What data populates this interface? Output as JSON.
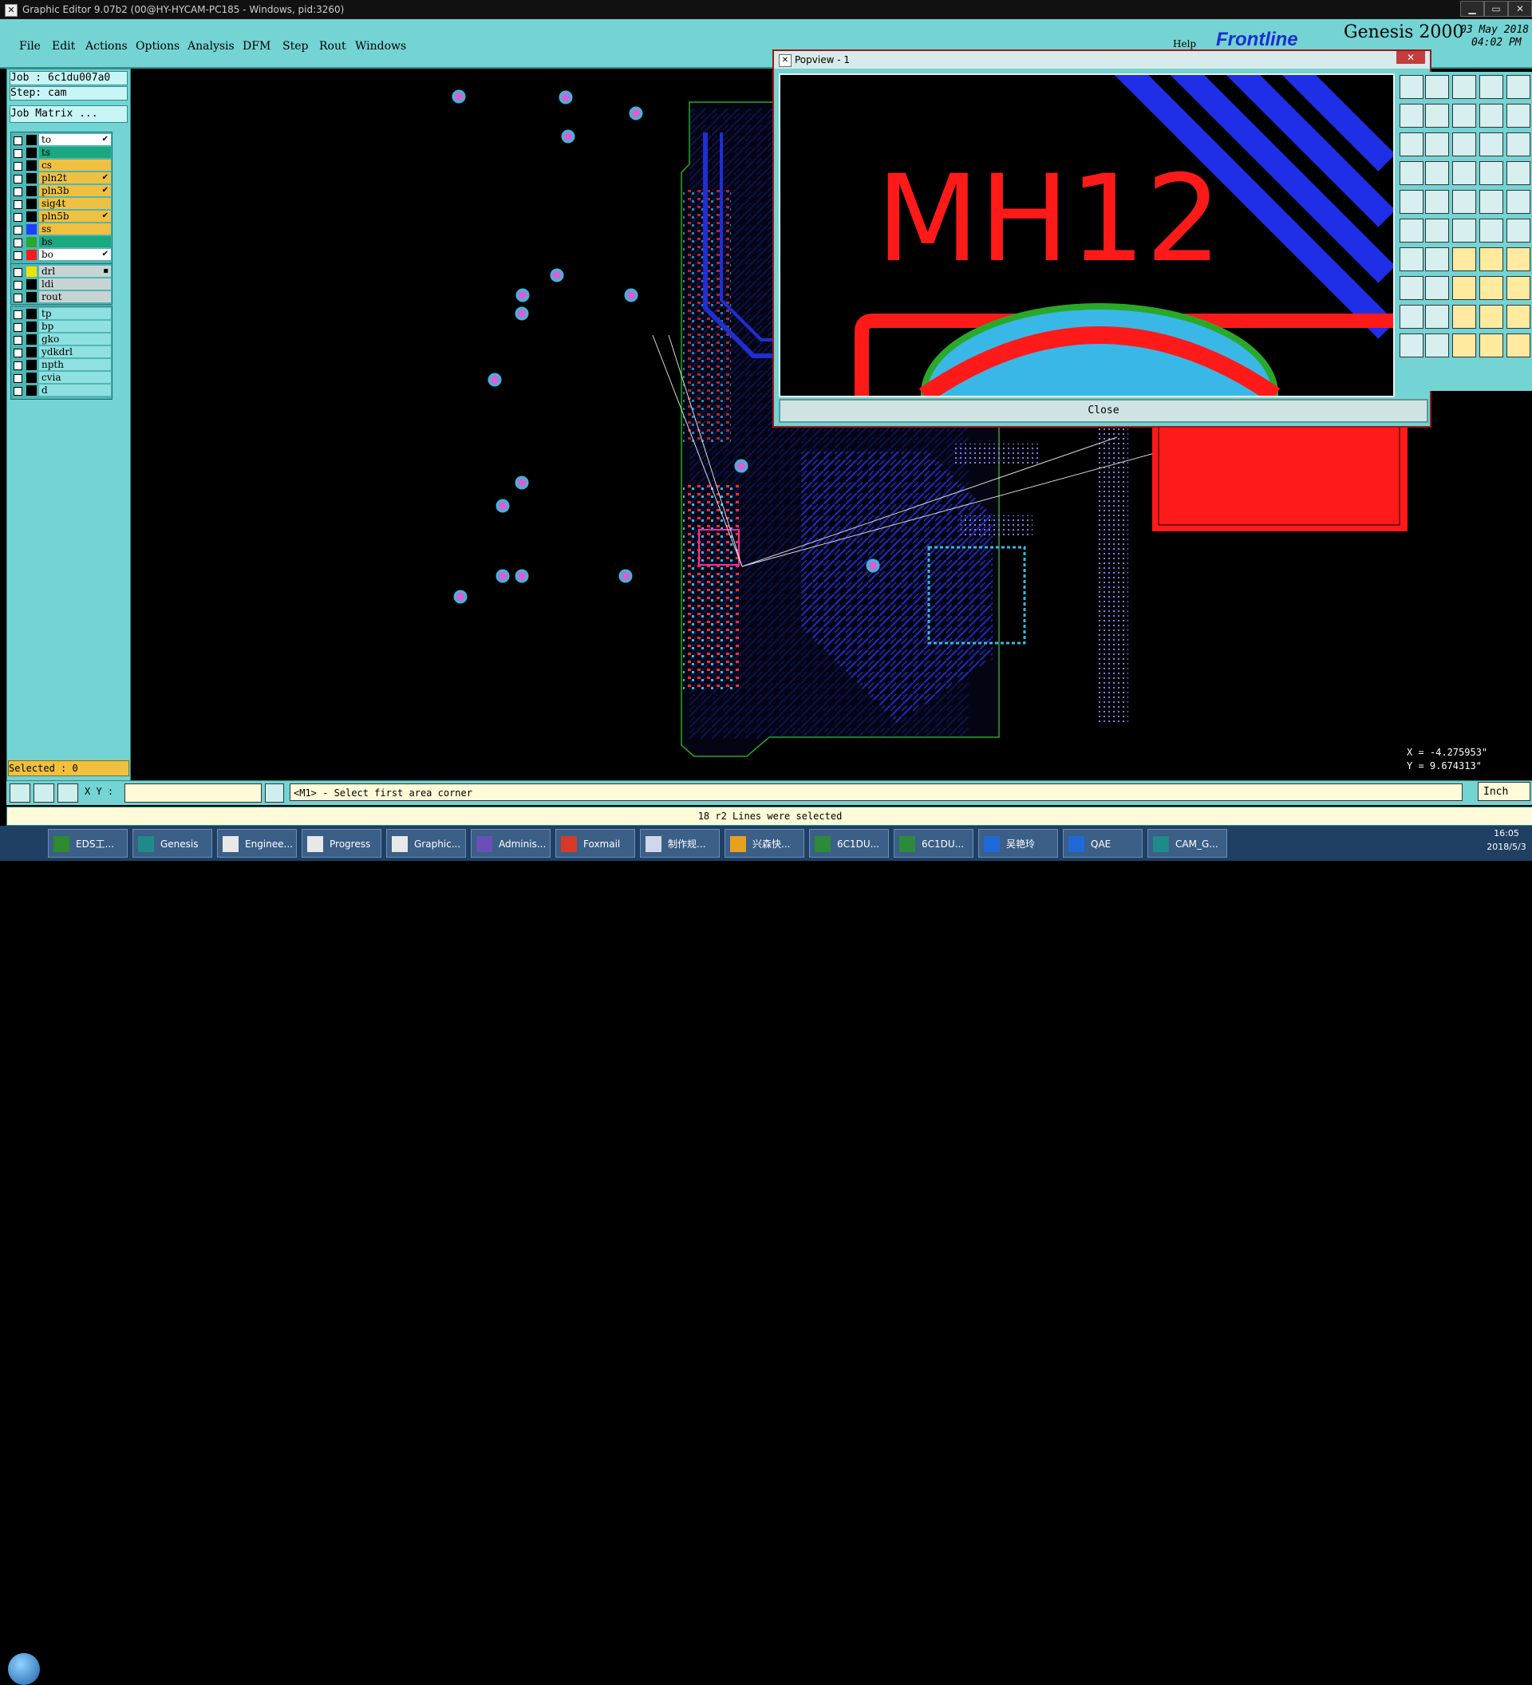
{
  "window": {
    "title": "Graphic Editor 9.07b2 (00@HY-HYCAM-PC185 - Windows, pid:3260)",
    "min": "▁",
    "max": "▭",
    "close": "✕"
  },
  "menu": [
    "File",
    "Edit",
    "Actions",
    "Options",
    "Analysis",
    "DFM",
    "Step",
    "Rout",
    "Windows"
  ],
  "brand": {
    "help": "Help",
    "logo": "Frontline",
    "product": "Genesis 2000",
    "date": "03 May 2018",
    "time": "04:02 PM"
  },
  "job": {
    "job_label": "Job : 6c1du007a0",
    "step_label": "Step: cam",
    "matrix": "Job Matrix ..."
  },
  "layers": [
    {
      "name": "to",
      "color": "#ffffff",
      "flag": "✔",
      "sw": "#000000"
    },
    {
      "name": "ts",
      "color": "#1aa880",
      "flag": "",
      "sw": "#000000"
    },
    {
      "name": "cs",
      "color": "#f0c040",
      "flag": "",
      "sw": "#000000"
    },
    {
      "name": "pln2t",
      "color": "#f0c040",
      "flag": "✔",
      "sw": "#000000"
    },
    {
      "name": "pln3b",
      "color": "#f0c040",
      "flag": "✔",
      "sw": "#000000"
    },
    {
      "name": "sig4t",
      "color": "#f0c040",
      "flag": "",
      "sw": "#000000"
    },
    {
      "name": "pln5b",
      "color": "#f0c040",
      "flag": "✔",
      "sw": "#000000"
    },
    {
      "name": "ss",
      "color": "#f0c040",
      "flag": "",
      "sw": "#1f3fff"
    },
    {
      "name": "bs",
      "color": "#1aa880",
      "flag": "",
      "sw": "#2aa82a"
    },
    {
      "name": "bo",
      "color": "#ffffff",
      "flag": "✔",
      "sw": "#ff1a1a"
    }
  ],
  "layers2": [
    {
      "name": "drl",
      "color": "#c8d4d4",
      "flag": "▪",
      "sw": "#f0e000"
    },
    {
      "name": "ldi",
      "color": "#c8d4d4",
      "flag": "",
      "sw": "#000000"
    },
    {
      "name": "rout",
      "color": "#c8d4d4",
      "flag": "",
      "sw": "#000000"
    }
  ],
  "layers3": [
    {
      "name": "tp",
      "color": "#8fe0e0",
      "flag": "",
      "sw": "#000000"
    },
    {
      "name": "bp",
      "color": "#8fe0e0",
      "flag": "",
      "sw": "#000000"
    },
    {
      "name": "gko",
      "color": "#8fe0e0",
      "flag": "",
      "sw": "#000000"
    },
    {
      "name": "ydkdrl",
      "color": "#8fe0e0",
      "flag": "",
      "sw": "#000000"
    },
    {
      "name": "npth",
      "color": "#8fe0e0",
      "flag": "",
      "sw": "#000000"
    },
    {
      "name": "cvia",
      "color": "#8fe0e0",
      "flag": "",
      "sw": "#000000"
    },
    {
      "name": "d",
      "color": "#8fe0e0",
      "flag": "",
      "sw": "#000000"
    }
  ],
  "selected": "Selected : 0",
  "popview": {
    "title": "Popview - 1",
    "text": "MH12",
    "close": "Close"
  },
  "coords": {
    "x": "X = -4.275953\"",
    "y": "Y = 9.674313\""
  },
  "xy_label": "X Y :",
  "prompt": "<M1> - Select first area corner",
  "status": "18 r2 Lines were selected",
  "unit": "Inch",
  "taskbar": [
    {
      "label": "EDS工...",
      "icon": "#2d8a2d"
    },
    {
      "label": "Genesis",
      "icon": "#1f8a8a"
    },
    {
      "label": "Enginee...",
      "icon": "#e8e8e8"
    },
    {
      "label": "Progress",
      "icon": "#e8e8e8"
    },
    {
      "label": "Graphic...",
      "icon": "#e8e8e8"
    },
    {
      "label": "Adminis...",
      "icon": "#6a4fb8"
    },
    {
      "label": "Foxmail",
      "icon": "#d83a2a"
    },
    {
      "label": "制作规...",
      "icon": "#cfd8e8"
    },
    {
      "label": "兴森快...",
      "icon": "#e8a020"
    },
    {
      "label": "6C1DU...",
      "icon": "#2d8a3a"
    },
    {
      "label": "6C1DU...",
      "icon": "#2d8a3a"
    },
    {
      "label": "吴艳玲",
      "icon": "#1f6ad8"
    },
    {
      "label": "QAE",
      "icon": "#1f6ad8"
    },
    {
      "label": "CAM_G...",
      "icon": "#1f8a8a"
    }
  ],
  "clock": {
    "time": "16:05",
    "date": "2018/5/3"
  }
}
